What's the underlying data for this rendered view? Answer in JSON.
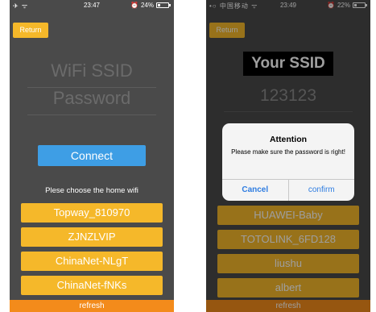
{
  "left_screen": {
    "status_bar": {
      "left": "✈ ᯤ",
      "time": "23:47",
      "alarm": "⏰",
      "battery": "24%",
      "battery_fraction": 0.24
    },
    "return_label": "Return",
    "ssid_placeholder": "WiFi SSID",
    "password_placeholder": "Password",
    "connect_label": "Connect",
    "hint": "Plese choose the home wifi",
    "wifi_list": [
      "Topway_810970",
      "ZJNZLVIP",
      "ChinaNet-NLgT",
      "ChinaNet-fNKs"
    ],
    "refresh_label": "refresh"
  },
  "right_screen": {
    "status_bar": {
      "left": "•○ 中国移动 ᯤ",
      "time": "23:49",
      "alarm": "⏰",
      "battery": "22%",
      "battery_fraction": 0.22
    },
    "return_label": "Return",
    "ssid_value": "Your SSID",
    "password_value": "123123",
    "dialog": {
      "title": "Attention",
      "message": "Please make sure the password is right!",
      "cancel_label": "Cancel",
      "confirm_label": "confirm"
    },
    "wifi_list": [
      "HUAWEI-Baby",
      "TOTOLINK_6FD128",
      "liushu",
      "albert"
    ],
    "refresh_label": "refresh"
  },
  "colors": {
    "accent": "#f5b82a",
    "connect": "#3e9ee5",
    "refresh": "#f38b1b",
    "screen_bg": "#4a4a4a"
  }
}
